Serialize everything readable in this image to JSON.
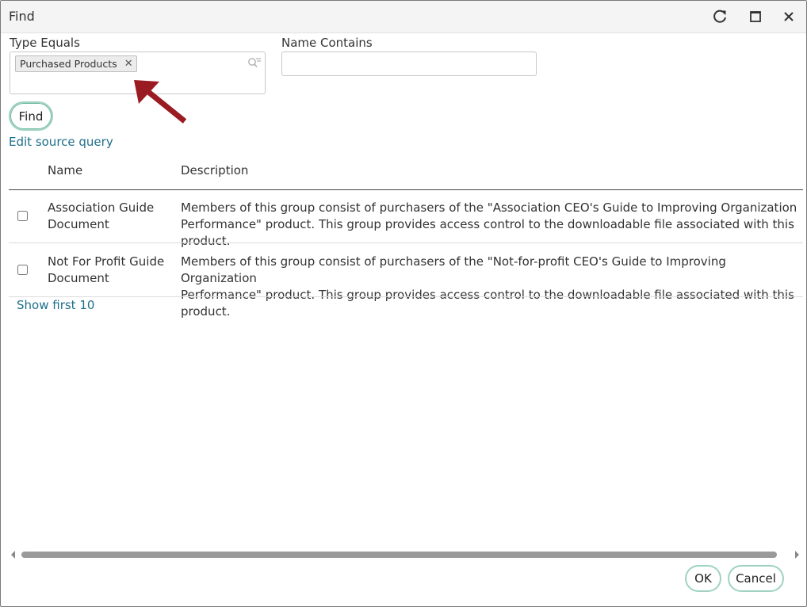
{
  "window": {
    "title": "Find",
    "refresh_icon": "refresh-icon",
    "maximize_icon": "maximize-icon",
    "close_icon": "close-icon"
  },
  "filters": {
    "type_label": "Type Equals",
    "type_chips": [
      "Purchased Products"
    ],
    "name_label": "Name Contains",
    "name_value": "",
    "find_label": "Find",
    "edit_link": "Edit source query"
  },
  "table": {
    "headers": {
      "name": "Name",
      "description": "Description"
    },
    "rows": [
      {
        "name_line1": "Association Guide",
        "name_line2": "Document",
        "desc_line1": "Members of this group consist of purchasers of the \"Association CEO's Guide to Improving Organization",
        "desc_line2": "Performance\" product. This group provides access control to the downloadable file associated with this product.",
        "checked": false
      },
      {
        "name_line1": "Not For Profit Guide",
        "name_line2": "Document",
        "desc_line1": "Members of this group consist of purchasers of the \"Not-for-profit CEO's Guide to Improving Organization",
        "desc_line2": "Performance\" product. This group provides access control to the downloadable file associated with this product.",
        "checked": false
      }
    ],
    "show_first": "Show first 10"
  },
  "footer": {
    "ok_label": "OK",
    "cancel_label": "Cancel"
  },
  "colors": {
    "accent_border": "#9fd3c0",
    "link": "#1f6f8b",
    "annotation_arrow": "#9b1b23"
  }
}
